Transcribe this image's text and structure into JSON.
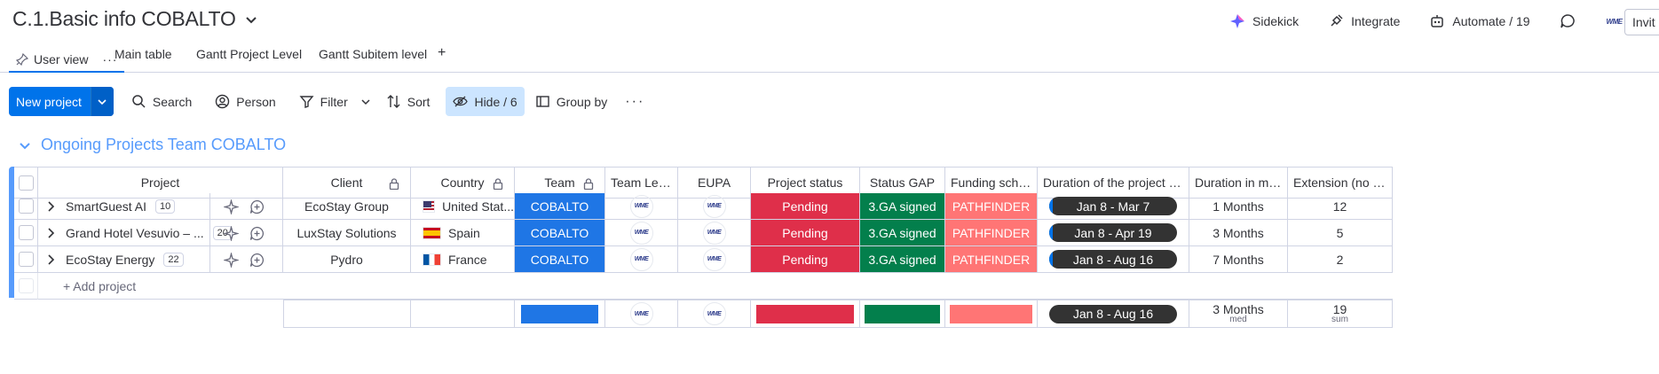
{
  "board": {
    "title": "C.1.Basic info COBALTO"
  },
  "top_actions": {
    "sidekick": "Sidekick",
    "integrate": "Integrate",
    "automate": "Automate / 19",
    "invite": "Invit"
  },
  "tabs": {
    "user_view": "User view",
    "main_table": "Main table",
    "gantt_project": "Gantt Project Level",
    "gantt_subitem": "Gantt Subitem level",
    "add": "+"
  },
  "toolbar": {
    "new_project": "New project",
    "search": "Search",
    "person": "Person",
    "filter": "Filter",
    "sort": "Sort",
    "hide": "Hide / 6",
    "group_by": "Group by"
  },
  "group": {
    "title": "Ongoing Projects Team COBALTO",
    "add_item": "+ Add project"
  },
  "columns": {
    "project": "Project",
    "client": "Client",
    "country": "Country",
    "team": "Team",
    "team_lead": "Team Lea...",
    "eupa": "EUPA",
    "project_status": "Project status",
    "status_gap": "Status GAP",
    "funding": "Funding sche...",
    "duration_project": "Duration of the project (inc...",
    "duration_months": "Duration in mon...",
    "extension": "Extension (no of..."
  },
  "rows": [
    {
      "name": "SmartGuest AI",
      "updates": "10",
      "client": "EcoStay Group",
      "country": "United Stat...",
      "flag": "us",
      "team": "COBALTO",
      "lead": "WME",
      "eupa": "WME",
      "status": "Pending",
      "gap": "3.GA signed",
      "funding": "PATHFINDER",
      "timeline": "Jan 8 - Mar 7",
      "duration": "1 Months",
      "extension": "12"
    },
    {
      "name": "Grand Hotel Vesuvio – ...",
      "updates": "20",
      "client": "LuxStay Solutions",
      "country": "Spain",
      "flag": "es",
      "team": "COBALTO",
      "lead": "WME",
      "eupa": "WME",
      "status": "Pending",
      "gap": "3.GA signed",
      "funding": "PATHFINDER",
      "timeline": "Jan 8 - Apr 19",
      "duration": "3 Months",
      "extension": "5"
    },
    {
      "name": "EcoStay Energy",
      "updates": "22",
      "client": "Pydro",
      "country": "France",
      "flag": "fr",
      "team": "COBALTO",
      "lead": "WME",
      "eupa": "WME",
      "status": "Pending",
      "gap": "3.GA signed",
      "funding": "PATHFINDER",
      "timeline": "Jan 8 - Aug 16",
      "duration": "7 Months",
      "extension": "2"
    }
  ],
  "summary": {
    "lead": "WME",
    "eupa": "WME",
    "timeline": "Jan 8 - Aug 16",
    "duration": "3 Months",
    "duration_sub": "med",
    "extension": "19",
    "extension_sub": "sum"
  },
  "colors": {
    "accent": "#0073ea",
    "group": "#579bfc",
    "team": "#1f76e5",
    "pending": "#df2f4a",
    "ga_signed": "#037f4c",
    "pathfinder": "#ff7575",
    "hide_bg": "#cce5ff"
  }
}
